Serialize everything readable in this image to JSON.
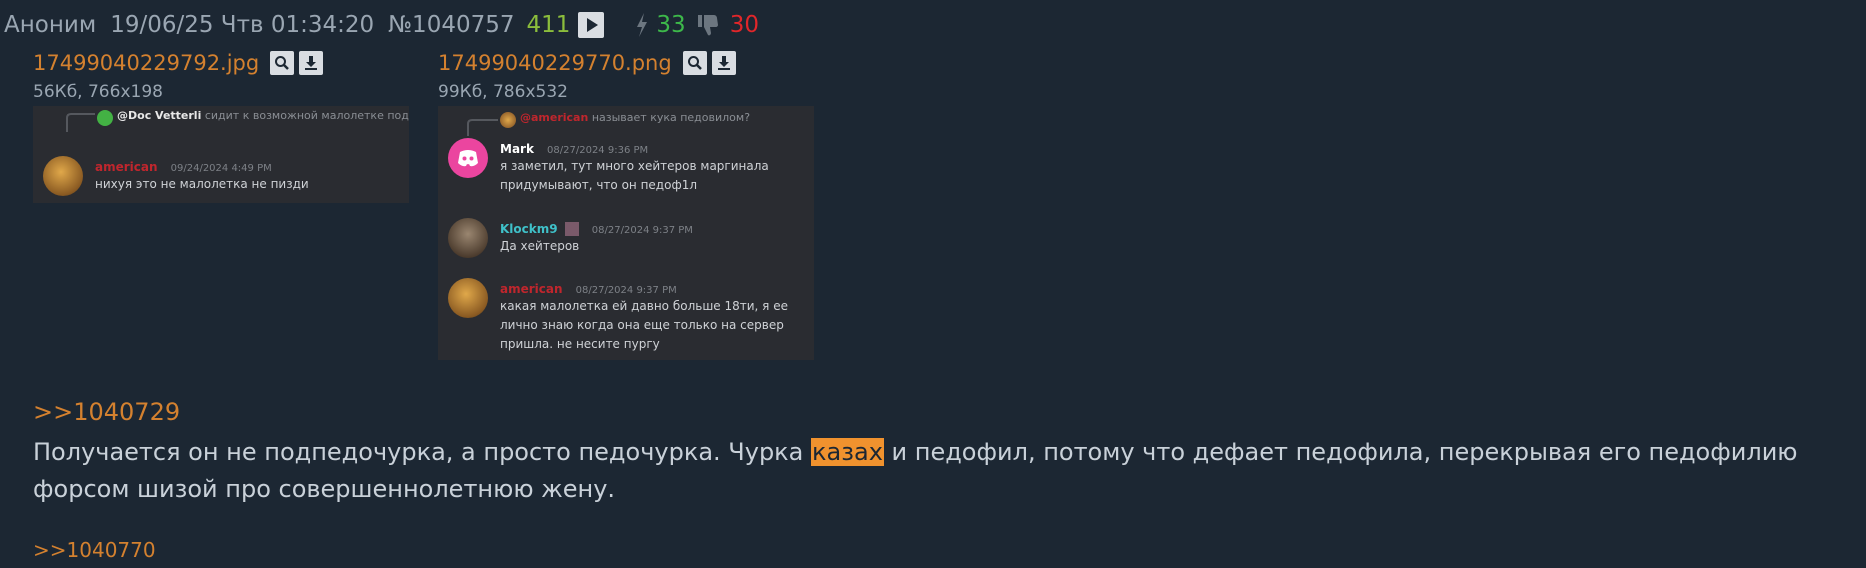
{
  "post": {
    "author": "Аноним",
    "date": "19/06/25 Чтв 01:34:20",
    "number": "№1040757",
    "reply_count": "411",
    "likes": "33",
    "dislikes": "30"
  },
  "files": [
    {
      "name": "17499040229792.jpg",
      "meta": "56Кб, 766x198",
      "preview": {
        "reply_to": "@Doc Vetterli",
        "reply_text": "сидит к возможной малолетке подкатывает",
        "author": "american",
        "time": "09/24/2024 4:49 PM",
        "text": "нихуя это не малолетка не пизди"
      }
    },
    {
      "name": "17499040229770.png",
      "meta": "99Кб, 786x532",
      "preview": {
        "reply_to": "@american",
        "reply_text": "называет кука педовилом?",
        "messages": [
          {
            "author": "Mark",
            "time": "08/27/2024 9:36 PM",
            "lines": [
              "я заметил, тут много хейтеров маргинала",
              "придумывают, что он педоф1л"
            ],
            "color": "#ffffff"
          },
          {
            "author": "Klockm9",
            "time": "08/27/2024 9:37 PM",
            "lines": [
              "Да хейтеров"
            ],
            "color": "#3fc1c9"
          },
          {
            "author": "american",
            "time": "08/27/2024 9:37 PM",
            "lines": [
              "какая малолетка ей давно больше 18ти, я ее",
              "лично знаю когда она еще только на сервер",
              "пришла. не несите пургу"
            ],
            "color": "#c0262d"
          }
        ]
      }
    }
  ],
  "reply_link_1": ">>1040729",
  "text_part1": "Получается он не подпедочурка, а просто педочурка. Чурка ",
  "text_highlight": "казах",
  "text_part2": " и педофил, потому что дефает педофила, перекрывая его педофилию форсом шизой про совершеннолетнюю жену.",
  "reply_link_2": ">>1040770",
  "colors": {
    "background": "#1c2733",
    "link": "#d4812f",
    "highlight": "#f0922e",
    "likes": "#3db84a",
    "dislikes": "#e0262a"
  }
}
